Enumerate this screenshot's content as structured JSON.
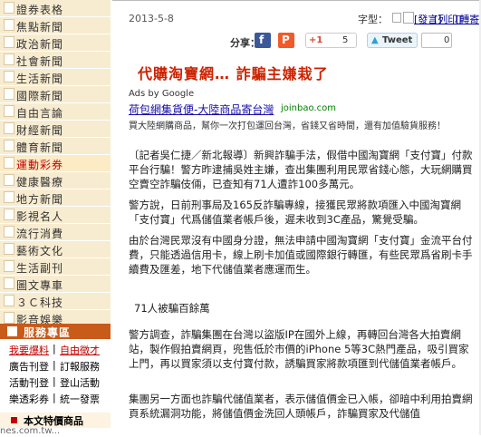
{
  "sidebar": {
    "nav_items": [
      {
        "label": "證券表格"
      },
      {
        "label": "焦點新聞"
      },
      {
        "label": "政治新聞"
      },
      {
        "label": "社會新聞"
      },
      {
        "label": "生活新聞"
      },
      {
        "label": "國際新聞"
      },
      {
        "label": "自由言論"
      },
      {
        "label": "財經新聞"
      },
      {
        "label": "體育新聞"
      },
      {
        "label": "運動彩券"
      },
      {
        "label": "健康醫療"
      },
      {
        "label": "地方新聞"
      },
      {
        "label": "影視名人"
      },
      {
        "label": "流行消費"
      },
      {
        "label": "藝術文化"
      },
      {
        "label": "生活副刊"
      },
      {
        "label": "圖文專車"
      },
      {
        "label": "３Ｃ科技"
      },
      {
        "label": "影音娛樂"
      }
    ],
    "service_header": "服務專區",
    "service_rows": [
      [
        "我要爆料",
        "自由徵才"
      ],
      [
        "廣告刊登",
        "訂報服務"
      ],
      [
        "活動刊登",
        "登山活動"
      ],
      [
        "樂透彩券",
        "統一發票"
      ]
    ],
    "separator": "|",
    "special_header": "本文特價商品",
    "status_url": "nes.com.tw..."
  },
  "article": {
    "date": "2013-5-8",
    "fontsize_label": "字型：",
    "fontsize_links": [
      "[發言]",
      "[列印]",
      "[轉寄]"
    ],
    "share_label": "分享：",
    "gplus_label": "+1",
    "gplus_count": "5",
    "tweet_label": "Tweet",
    "tweet_count": "0",
    "title": "代購淘寶網… 詐騙主嫌栽了",
    "ad": {
      "by": "Ads by Google",
      "title": "荷包網集貨便-大陸商品寄台灣",
      "domain": "joinbao.com",
      "desc": "買大陸網購商品，幫你一次打包運回台灣，省錢又省時間，還有加值驗貨服務！"
    },
    "paragraphs": [
      "〔記者吳仁捷／新北報導〕新興詐騙手法，假借中國淘寶網「支付寶」付款平台行騙！警方昨逮捕吳姓主嫌，查出集團利用民眾省錢心態，大玩網購買空賣空詐騙伎倆，已查知有71人遭詐100多萬元。",
      "警方說，日前刑事局及165反詐騙專線，接獲民眾將款項匯入中國淘寶網「支付寶」代爲儲值業者帳戶後，遲未收到3C產品，驚覺受騙。",
      "由於台灣民眾沒有中國身分證，無法申請中國淘寶網「支付寶」金流平台付費，只能透過信用卡，線上刷卡加值或國際銀行轉匯，有些民眾爲省刷卡手續費及匯差，地下代儲值業者應運而生。"
    ],
    "subhead": "71人被騙百餘萬",
    "paragraphs2": [
      "警方調查，詐騙集團在台灣以盜版IP在國外上線，再轉回台灣各大拍賣網站，製作假拍賣網頁，兜售低於市價的iPhone 5等3C熱門產品，吸引買家上門，再以買家須以支付寶付款，誘騙買家將款項匯到代儲值業者帳戶。",
      "集團另一方面也詐騙代儲值業者，表示儲值價金已入帳，卻暗中利用拍賣網頁系統漏洞功能，將儲值價金洗回人頭帳戶，詐騙買家及代儲值"
    ]
  }
}
